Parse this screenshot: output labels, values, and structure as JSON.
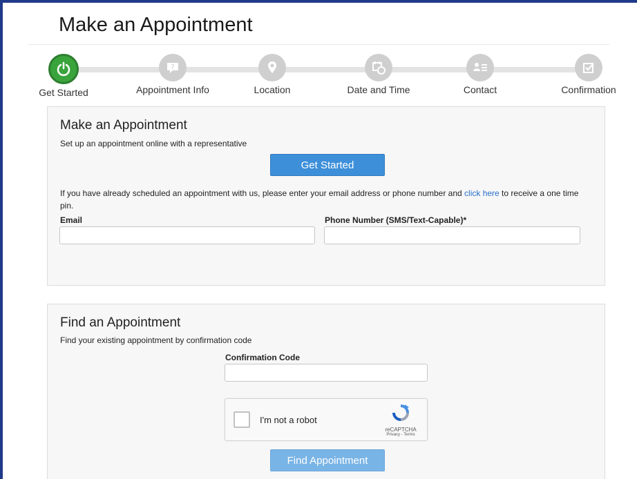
{
  "page": {
    "title": "Make an Appointment"
  },
  "steps": [
    {
      "label": "Get Started",
      "icon": "power-icon",
      "active": true
    },
    {
      "label": "Appointment Info",
      "icon": "question-icon",
      "active": false
    },
    {
      "label": "Location",
      "icon": "location-pin-icon",
      "active": false
    },
    {
      "label": "Date and Time",
      "icon": "calendar-clock-icon",
      "active": false
    },
    {
      "label": "Contact",
      "icon": "contact-card-icon",
      "active": false
    },
    {
      "label": "Confirmation",
      "icon": "checkbox-icon",
      "active": false
    }
  ],
  "make": {
    "heading": "Make an Appointment",
    "subtitle": "Set up an appointment online with a representative",
    "get_started_label": "Get Started",
    "info_before": "If you have already scheduled an appointment with us, please enter your email address or phone number and ",
    "info_link": "click here",
    "info_after": " to receive a one time pin.",
    "email_label": "Email",
    "email_value": "",
    "phone_label": "Phone Number (SMS/Text-Capable)*",
    "phone_value": ""
  },
  "find": {
    "heading": "Find an Appointment",
    "subtitle": "Find your existing appointment by confirmation code",
    "code_label": "Confirmation Code",
    "code_value": "",
    "recaptcha_label": "I'm not a robot",
    "recaptcha_brand": "reCAPTCHA",
    "recaptcha_links": "Privacy - Terms",
    "find_label": "Find Appointment"
  },
  "colors": {
    "active_step": "#3aa43c",
    "primary": "#3d8fd9",
    "frame": "#1f3a8a",
    "link": "#2a6fc9"
  }
}
